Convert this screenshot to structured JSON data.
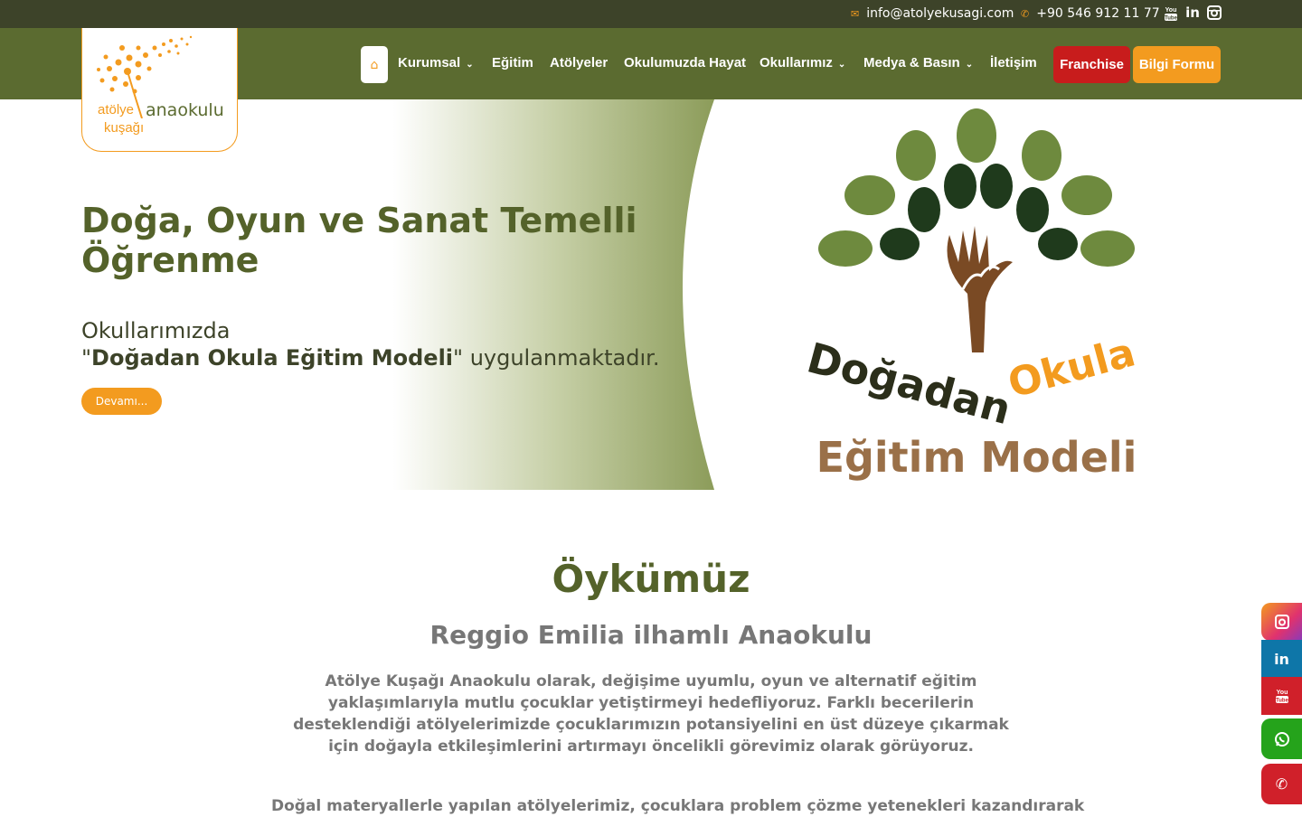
{
  "topbar": {
    "email": "info@atolyekusagi.com",
    "phone": "+90 546 912 11 77",
    "icons": [
      "envelope-icon",
      "phone-icon",
      "youtube-icon",
      "linkedin-icon",
      "instagram-icon"
    ],
    "social_youtube_label": "You Tube",
    "social_linkedin_label": "in"
  },
  "logo": {
    "word1": "atölye",
    "word2": "anaokulu",
    "word3": "kuşağı"
  },
  "nav": {
    "items": [
      {
        "label": "Kurumsal",
        "has_dropdown": true
      },
      {
        "label": "Eğitim",
        "has_dropdown": false
      },
      {
        "label": "Atölyeler",
        "has_dropdown": false
      },
      {
        "label": "Okulumuzda Hayat",
        "has_dropdown": false
      },
      {
        "label": "Okullarımız",
        "has_dropdown": true
      },
      {
        "label": "Medya & Basın",
        "has_dropdown": true
      },
      {
        "label": "İletişim",
        "has_dropdown": false
      }
    ],
    "franchise_label": "Franchise",
    "bilgi_label": "Bilgi Formu"
  },
  "hero": {
    "title": "Doğa, Oyun ve Sanat Temelli Öğrenme",
    "subtitle_line1": "Okullarımızda",
    "subtitle_quote_open": "\"",
    "subtitle_bold": "Doğadan Okula Eğitim Modeli",
    "subtitle_rest": "\" uygulanmaktadır.",
    "button_label": "Devamı...",
    "image_text1": "Doğadan",
    "image_text2": "Okula",
    "image_text3": "Eğitim Modeli"
  },
  "section": {
    "title": "Öykümüz",
    "subtitle": "Reggio Emilia ilhamlı Anaokulu",
    "paragraph": "Atölye Kuşağı Anaokulu olarak, değişime uyumlu, oyun ve alternatif eğitim yaklaşımlarıyla mutlu çocuklar yetiştirmeyi hedefliyoruz. Farklı becerilerin desteklendiği atölyelerimizde çocuklarımızın potansiyelini en üst düzeye çıkarmak için doğayla etkileşimlerini artırmayı öncelikli görevimiz olarak görüyoruz.",
    "paragraph2": "Doğal materyallerle yapılan atölyelerimiz, çocuklara problem çözme yetenekleri kazandırarak"
  },
  "colors": {
    "topbar": "#3d4329",
    "navbar": "#5b6b30",
    "accent": "#f39b1f",
    "franchise": "#c81c1c",
    "instagram": "#e0326e",
    "linkedin": "#0e76a8",
    "youtube": "#d0202a",
    "whatsapp": "#25a31b",
    "call": "#d0202a"
  },
  "side_buttons": [
    "instagram-icon",
    "linkedin-icon",
    "youtube-icon",
    "whatsapp-icon",
    "phone-icon"
  ]
}
